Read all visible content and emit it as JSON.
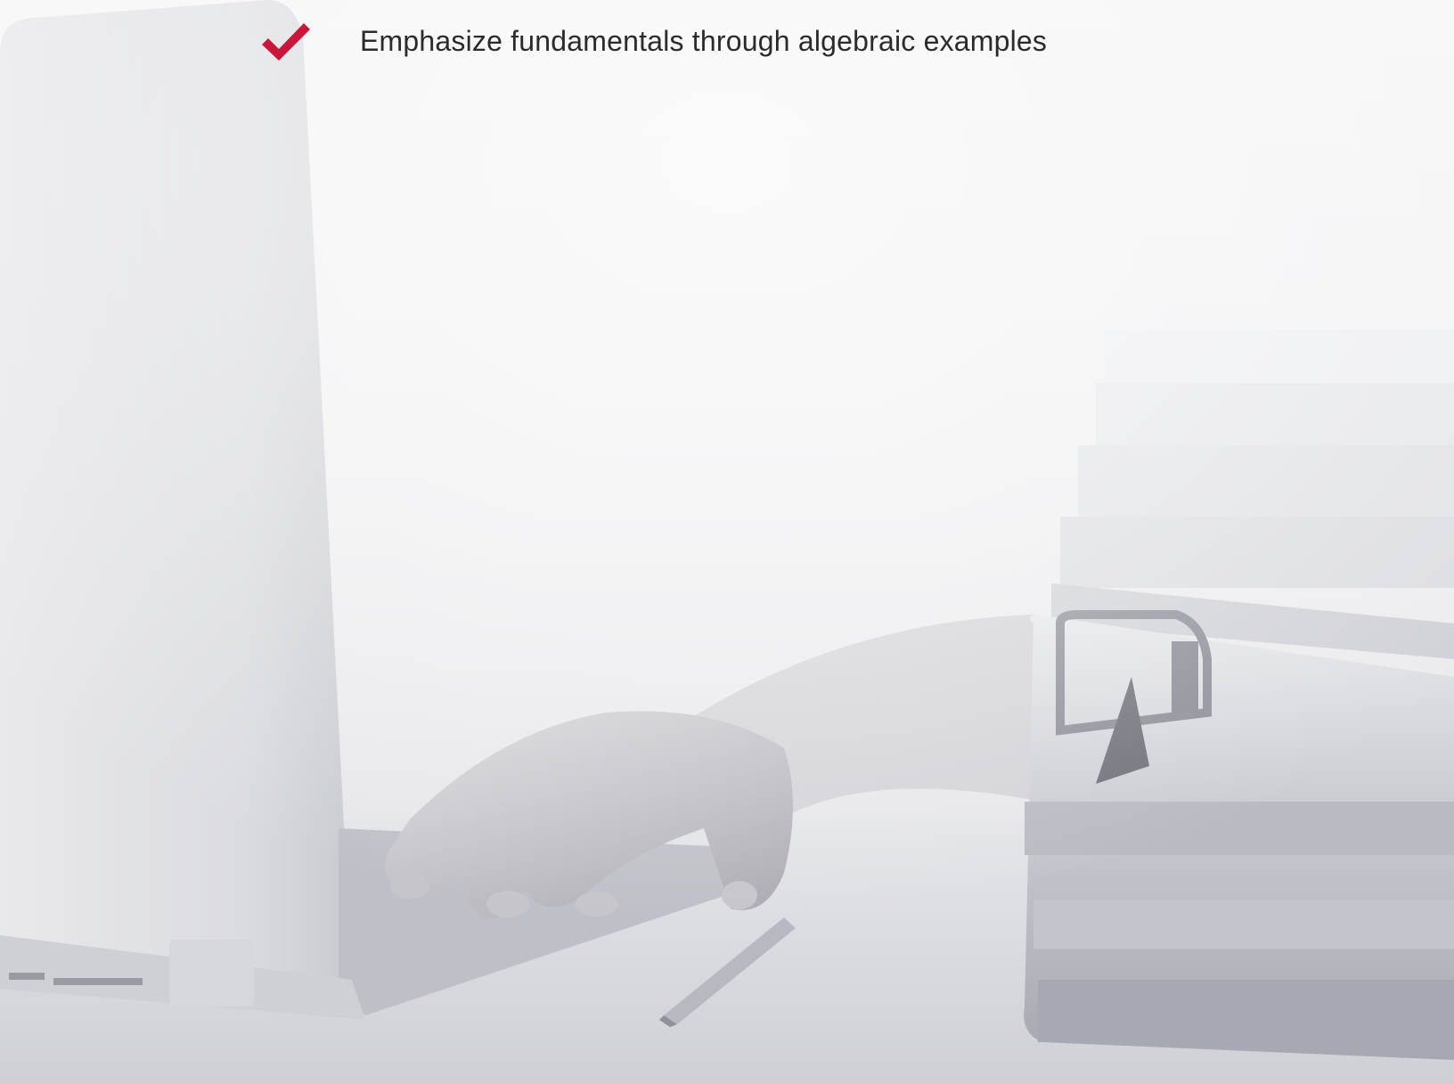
{
  "bullets": [
    {
      "icon": "checkmark-icon",
      "text": "Emphasize fundamentals through algebraic examples"
    }
  ],
  "colors": {
    "accent": "#c8173a",
    "text": "#2b2b2e",
    "background": "#f6f6f7"
  },
  "background_image": {
    "description_icon": "laptop-typing-photo"
  }
}
